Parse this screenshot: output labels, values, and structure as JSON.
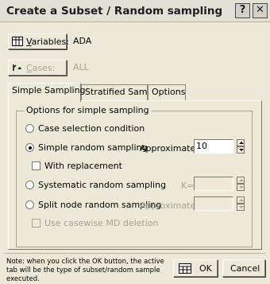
{
  "window": {
    "title": "Create a Subset / Random sampling",
    "help_glyph": "?",
    "close_glyph": "✕"
  },
  "variables": {
    "button_label_u": "V",
    "button_label_rest": "ariables:",
    "value": "ADA",
    "icon": "table-icon"
  },
  "cases": {
    "button_label_u": "C",
    "button_label_rest": "ases:",
    "value": "ALL",
    "icon": "cases-icon"
  },
  "tabs": [
    {
      "label": "Simple Sampling",
      "active": true
    },
    {
      "label": "Stratified Sampling",
      "active": false
    },
    {
      "label": "Options",
      "active": false
    }
  ],
  "group": {
    "title": "Options for simple sampling"
  },
  "options": {
    "case_selection": {
      "label": "Case selection condition",
      "checked": false
    },
    "simple_random": {
      "label": "Simple random sampling",
      "checked": true,
      "approx_label": "Approximate %=",
      "approx_value": "10"
    },
    "with_replacement": {
      "label": "With replacement",
      "checked": false
    },
    "systematic": {
      "label": "Systematic random sampling",
      "checked": false,
      "k_label": "K=",
      "k_value": ""
    },
    "split_node": {
      "label": "Split node random sampling",
      "checked": false,
      "approx_label": "Approximate %=",
      "approx_value": ""
    },
    "casewise_md": {
      "label": "Use casewise MD deletion",
      "checked": false,
      "disabled": true
    }
  },
  "footer": {
    "note": "Note: when you click the OK button, the active tab will be the type of subset/random sample executed.",
    "ok_label": "OK",
    "cancel_label": "Cancel",
    "ok_icon": "grid-icon"
  }
}
